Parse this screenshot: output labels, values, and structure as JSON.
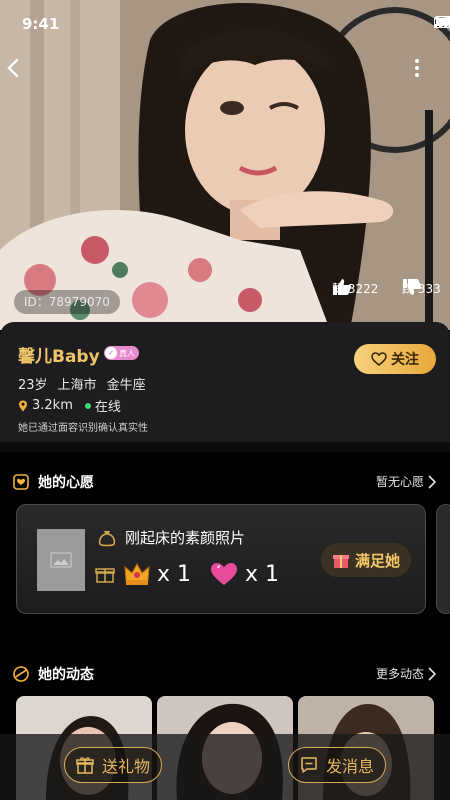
{
  "status": {
    "time": "9:41"
  },
  "hero": {
    "user_id": "ID：78979070",
    "likes": "赞 3222",
    "dislikes": "踩 333"
  },
  "profile": {
    "name": "馨儿Baby",
    "real_badge": "真人",
    "follow_label": "关注",
    "age": "23岁",
    "city": "上海市",
    "zodiac": "金牛座",
    "distance": "3.2km",
    "online": "在线",
    "verify_note": "她已通过面容识别确认真实性"
  },
  "wish": {
    "section_title": "她的心愿",
    "more_label": "暂无心愿",
    "item_title": "刚起床的素颜照片",
    "gifts": [
      {
        "icon": "crown-gift-icon",
        "count": "x 1"
      },
      {
        "icon": "heart-gift-icon",
        "count": "x 1"
      }
    ],
    "satisfy_label": "满足她"
  },
  "moments": {
    "section_title": "她的动态",
    "more_label": "更多动态"
  },
  "bottom": {
    "gift_label": "送礼物",
    "message_label": "发消息"
  },
  "colors": {
    "accent_gold": "#f1c56b",
    "panel_bg": "#1d1d1f",
    "online_green": "#3ddc6f",
    "badge_pink": "#e88ad0"
  }
}
